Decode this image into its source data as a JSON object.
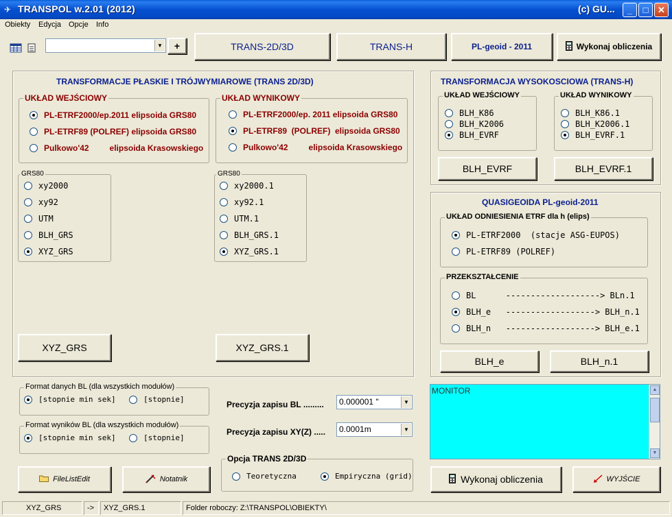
{
  "window": {
    "title": "TRANSPOL w.2.01 (2012)",
    "title_right": "(c) GU...",
    "min": "_",
    "max": "□",
    "close": "✕"
  },
  "menu": [
    "Obiekty",
    "Edycja",
    "Opcje",
    "Info"
  ],
  "toolbar": {
    "combo_value": "",
    "plus": "+",
    "trans2d": "TRANS-2D/3D",
    "transh": "TRANS-H",
    "plgeoid": "PL-geoid - 2011",
    "compute": "Wykonaj obliczenia"
  },
  "trans2d": {
    "title": "TRANSFORMACJE PŁASKIE I TRÓJWYMIAROWE (TRANS 2D/3D)",
    "input": {
      "legend": "UKŁAD WEJŚCIOWY",
      "options": [
        {
          "label": "PL-ETRF2000/ep.2011 elipsoida GRS80",
          "checked": true
        },
        {
          "label": "PL-ETRF89  (POLREF) elipsoida GRS80",
          "checked": false
        },
        {
          "label": "Pulkowo'42         elipsoida Krasowskiego",
          "checked": false
        }
      ]
    },
    "output": {
      "legend": "UKŁAD WYNIKOWY",
      "options": [
        {
          "label": "PL-ETRF2000/ep. 2011 elipsoida GRS80",
          "checked": false
        },
        {
          "label": "PL-ETRF89  (POLREF)  elipsoida GRS80",
          "checked": true
        },
        {
          "label": "Pulkowo'42         elipsoida Krasowskiego",
          "checked": false
        }
      ]
    },
    "grs_left": {
      "legend": "GRS80",
      "options": [
        {
          "label": "xy2000",
          "checked": false
        },
        {
          "label": "xy92",
          "checked": false
        },
        {
          "label": "UTM",
          "checked": false
        },
        {
          "label": "BLH_GRS",
          "checked": false
        },
        {
          "label": "XYZ_GRS",
          "checked": true
        }
      ],
      "button": "XYZ_GRS"
    },
    "grs_right": {
      "legend": "GRS80",
      "options": [
        {
          "label": "xy2000.1",
          "checked": false
        },
        {
          "label": "xy92.1",
          "checked": false
        },
        {
          "label": "UTM.1",
          "checked": false
        },
        {
          "label": "BLH_GRS.1",
          "checked": false
        },
        {
          "label": "XYZ_GRS.1",
          "checked": true
        }
      ],
      "button": "XYZ_GRS.1"
    }
  },
  "transh": {
    "title": "TRANSFORMACJA WYSOKOSCIOWA (TRANS-H)",
    "input": {
      "legend": "UKŁAD WEJŚCIOWY",
      "options": [
        {
          "label": "BLH_K86",
          "checked": false
        },
        {
          "label": "BLH_K2006",
          "checked": false
        },
        {
          "label": "BLH_EVRF",
          "checked": true
        }
      ],
      "button": "BLH_EVRF"
    },
    "output": {
      "legend": "UKŁAD WYNIKOWY",
      "options": [
        {
          "label": "BLH_K86.1",
          "checked": false
        },
        {
          "label": "BLH_K2006.1",
          "checked": false
        },
        {
          "label": "BLH_EVRF.1",
          "checked": true
        }
      ],
      "button": "BLH_EVRF.1"
    }
  },
  "geoid": {
    "title": "QUASIGEOIDA PL-geoid-2011",
    "ref": {
      "legend": "UKŁAD ODNIESIENIA ETRF dla h (elips)",
      "options": [
        {
          "label": "PL-ETRF2000  (stacje ASG-EUPOS)",
          "checked": true
        },
        {
          "label": "PL-ETRF89 (POLREF)",
          "checked": false
        }
      ]
    },
    "conv": {
      "legend": "PRZEKSZTAŁCENIE",
      "options": [
        {
          "label": "BL      -------------------> BLn.1",
          "checked": false
        },
        {
          "label": "BLH_e   ------------------> BLH_n.1",
          "checked": true
        },
        {
          "label": "BLH_n   ------------------> BLH_e.1",
          "checked": false
        }
      ]
    },
    "btn_e": "BLH_e",
    "btn_n": "BLH_n.1"
  },
  "format_in": {
    "legend": "Format danych BL (dla wszystkich modułów)",
    "opt1": "[stopnie min sek]",
    "opt2": "[stopnie]"
  },
  "format_out": {
    "legend": "Format wyników BL (dla wszystkich modułów)",
    "opt1": "[stopnie min sek]",
    "opt2": "[stopnie]"
  },
  "precision": {
    "bl_label": "Precyzja  zapisu  BL .........",
    "bl_value": "0.000001 \"",
    "xy_label": "Precyzja  zapisu  XY(Z) .....",
    "xy_value": "0.0001m"
  },
  "option2d": {
    "legend": "Opcja TRANS 2D/3D",
    "opt1": "Teoretyczna",
    "opt2": "Empiryczna (grid)"
  },
  "monitor": {
    "text": "MONITOR"
  },
  "bottom_buttons": {
    "filelist": "FileListEdit",
    "notatnik": "Notatnik",
    "compute": "Wykonaj obliczenia",
    "exit": "WYJŚCIE"
  },
  "status": {
    "input": "XYZ_GRS",
    "arrow": "->",
    "output": "XYZ_GRS.1",
    "folder": "Folder roboczy: Z:\\TRANSPOL\\OBIEKTY\\"
  }
}
